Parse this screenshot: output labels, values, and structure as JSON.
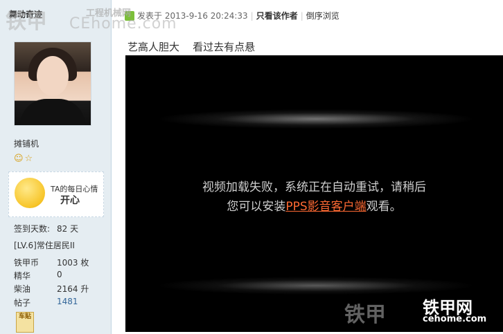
{
  "author": {
    "username": "舞动奇迹",
    "rank_title": "摊铺机",
    "medals": "☺☆",
    "mood_label": "TA的每日心情",
    "mood_value": "开心"
  },
  "stats": [
    {
      "label": "签到天数:",
      "value": "82 天"
    },
    {
      "label": "[LV.6]常住居民II",
      "value": ""
    },
    {
      "label": "铁甲币",
      "value": "1003 枚"
    },
    {
      "label": "精华",
      "value": "0"
    },
    {
      "label": "柴油",
      "value": "2164 升"
    },
    {
      "label": "帖子",
      "value": "1481"
    }
  ],
  "badge_text": "车贴",
  "post": {
    "posted_label": "发表于",
    "timestamp": "2013-9-16 20:24:33",
    "author_only": "只看该作者",
    "reverse": "倒序浏览",
    "message": "艺高人胆大    看过去有点悬"
  },
  "video": {
    "line1": "视频加载失败，系统正在自动重试，请稍后",
    "line2_prefix": "您可以安装",
    "line2_link": "PPS影音客户端",
    "line2_suffix": "观看。"
  },
  "watermark": {
    "top_left": "铁甲",
    "top_left_small": "工程机械网",
    "top_left_domain": "CEhome.com",
    "bottom_right": "铁甲",
    "bottom_right_brand": "铁甲网",
    "bottom_right_domain": "cehome.com"
  }
}
